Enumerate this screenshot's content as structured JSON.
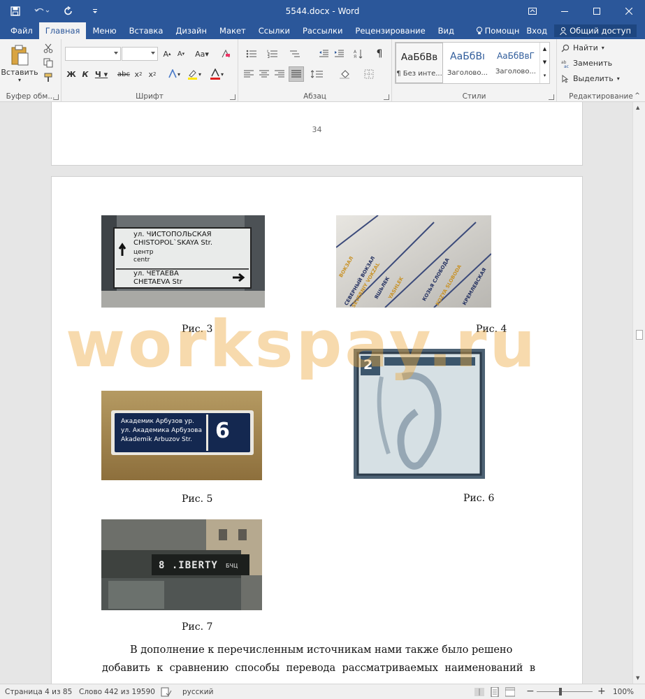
{
  "window": {
    "title": "5544.docx - Word"
  },
  "tabs": [
    {
      "label": "Файл"
    },
    {
      "label": "Главная"
    },
    {
      "label": "Меню"
    },
    {
      "label": "Вставка"
    },
    {
      "label": "Дизайн"
    },
    {
      "label": "Макет"
    },
    {
      "label": "Ссылки"
    },
    {
      "label": "Рассылки"
    },
    {
      "label": "Рецензирование"
    },
    {
      "label": "Вид"
    }
  ],
  "tabs_right": {
    "help": "Помощн",
    "login": "Вход",
    "share": "Общий доступ"
  },
  "ribbon": {
    "clipboard": {
      "paste": "Вставить",
      "label": "Буфер обм..."
    },
    "font": {
      "label": "Шрифт",
      "font_name": "",
      "font_size": ""
    },
    "paragraph": {
      "label": "Абзац"
    },
    "styles": {
      "label": "Стили",
      "items": [
        {
          "preview": "АаБбВв",
          "name": "¶ Без инте..."
        },
        {
          "preview": "АаБбВı",
          "name": "Заголово..."
        },
        {
          "preview": "АаБбВвГ",
          "name": "Заголово..."
        }
      ]
    },
    "editing": {
      "label": "Редактирование",
      "find": "Найти",
      "replace": "Заменить",
      "select": "Выделить"
    }
  },
  "document": {
    "page_number": "34",
    "captions": {
      "fig3": "Рис. 3",
      "fig4": "Рис. 4",
      "fig5": "Рис. 5",
      "fig6": "Рис. 6",
      "fig7": "Рис. 7"
    },
    "photo3": {
      "line1": "ул. ЧИСТОПОЛЬСКАЯ",
      "line2": "CHISTOPOL`SKAYA Str.",
      "line3": "центр",
      "line4": "centr",
      "line5": "ул. ЧЕТАЕВА",
      "line6": "CHETAEVA Str"
    },
    "photo4": {
      "s1": "ВОКЗАЛ",
      "s2": "СЕВЕРНЫЙ ВОКЗАЛ",
      "s3": "SEVERNIY VOKZAL",
      "s4": "ЯШЬЛЕК",
      "s5": "YASHLEK",
      "s6": "КОЗЬЯ СЛОБОДА",
      "s7": "KOZYA SLOBODA",
      "s8": "КРЕМЛЕВСКАЯ"
    },
    "photo5": {
      "line1": "Академик Арбузов ур.",
      "line2": "ул. Академика Арбузова",
      "line3": "Akademik Arbuzov Str.",
      "number": "6"
    },
    "photo6": {
      "number": "2"
    },
    "photo7": {
      "display": "8 .IBERTY",
      "suffix": "БЧЦ"
    },
    "watermark": "workspay.ru",
    "body_lines": [
      "В дополнение к перечисленным источникам нами также было решено",
      "добавить к сравнению способы перевода рассматриваемых наименований в"
    ]
  },
  "status": {
    "page": "Страница 4 из 85",
    "words": "Слово 442 из 19590",
    "language": "русский",
    "zoom": "100%"
  }
}
